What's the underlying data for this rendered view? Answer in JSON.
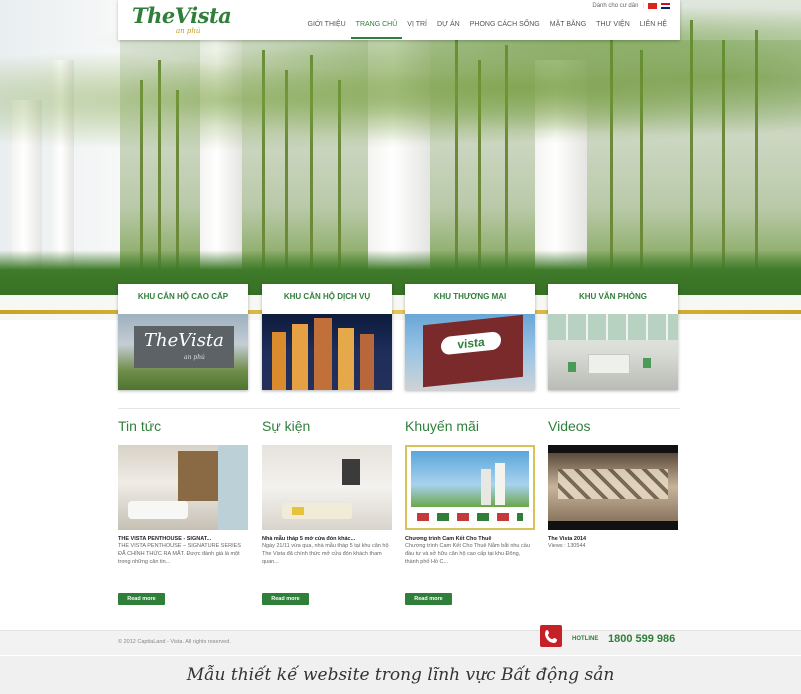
{
  "brand": {
    "logo": "TheVista",
    "logo_sub": "an phú"
  },
  "lang": {
    "label": "Dành cho cư dân"
  },
  "nav": [
    {
      "label": "GIỚI THIỆU",
      "active": false
    },
    {
      "label": "TRANG CHỦ",
      "active": true
    },
    {
      "label": "VỊ TRÍ",
      "active": false
    },
    {
      "label": "DỰ ÁN",
      "active": false
    },
    {
      "label": "PHONG CÁCH SỐNG",
      "active": false
    },
    {
      "label": "MẶT BẰNG",
      "active": false
    },
    {
      "label": "THƯ VIỆN",
      "active": false
    },
    {
      "label": "LIÊN HỆ",
      "active": false
    }
  ],
  "categories": [
    {
      "title": "KHU CĂN HỘ CAO CẤP",
      "sign": "TheVista",
      "sign_sub": "an phú"
    },
    {
      "title": "KHU CĂN HỘ DỊCH VỤ"
    },
    {
      "title": "KHU THƯƠNG MẠI",
      "sign": "vista"
    },
    {
      "title": "KHU VĂN PHÒNG"
    }
  ],
  "sections": [
    {
      "heading": "Tin tức",
      "title": "THE VISTA PENTHOUSE - SIGNAT...",
      "text": "THE VISTA PENTHOUSE – SIGNATURE SERIES ĐÃ CHÍNH THỨC RA MẮT. Được đánh giá là một trong những căn tin...",
      "button": "Read more"
    },
    {
      "heading": "Sự kiện",
      "title": "Nhà mẫu tháp 5 mở cửa đón khác...",
      "text": "Ngày 21/11 vừa qua, nhà mẫu tháp 5 tại khu căn hộ The Vista đã chính thức mở cửa đón khách tham quan...",
      "button": "Read more"
    },
    {
      "heading": "Khuyến mãi",
      "title": "Chương trình Cam Kết Cho Thuê",
      "text": "Chương trình Cam Kết Cho Thuê Nằm bắt nhu cầu đầu tư và sở hữu căn hộ cao cấp tại khu Đông, thành phố Hồ C...",
      "button": "Read more"
    },
    {
      "heading": "Videos",
      "title": "The Vista 2014",
      "text": "Views : 130544",
      "button": ""
    }
  ],
  "footer": {
    "copyright": "© 2012 CaptiaLand - Vista. All rights reserved.",
    "hotline_label": "HOTLINE",
    "hotline_number": "1800 599 986"
  },
  "caption": "Mẫu thiết kế website trong lĩnh vực Bất động sản",
  "colors": {
    "accent": "#2f7f3b",
    "gold": "#c9a323",
    "hotline_red": "#c62127"
  }
}
